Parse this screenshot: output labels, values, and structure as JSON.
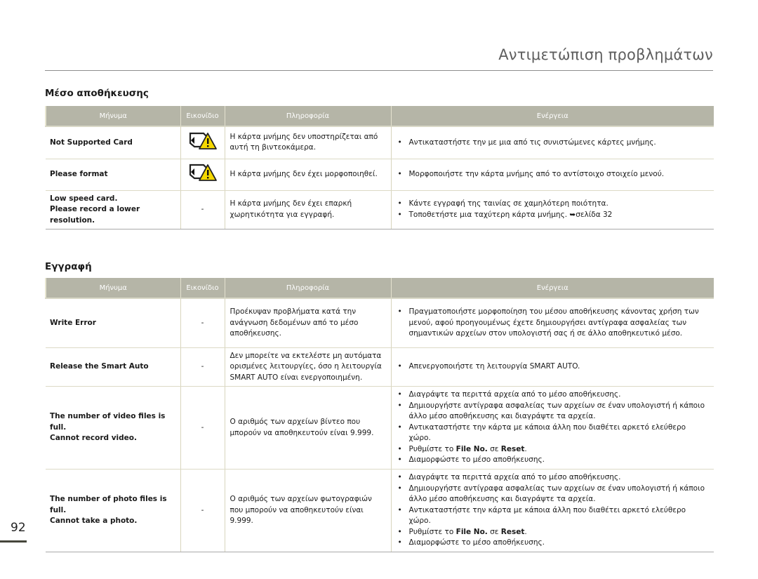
{
  "header": {
    "title": "Αντιμετώπιση προβλημάτων"
  },
  "columns": {
    "message": "Μήνυμα",
    "icon": "Εικονίδιο",
    "info": "Πληροφορία",
    "action": "Ενέργεια"
  },
  "sections": [
    {
      "title": "Μέσο αποθήκευσης",
      "rows": [
        {
          "message": "Not Supported Card",
          "icon": "card-warning-icon",
          "info": "Η κάρτα μνήμης δεν υποστηρίζεται από αυτή τη βιντεοκάμερα.",
          "actions": [
            "Αντικαταστήστε την με μια από τις συνιστώμενες κάρτες μνήμης."
          ]
        },
        {
          "message": "Please format",
          "icon": "card-warning-icon",
          "info": "Η κάρτα μνήμης δεν έχει μορφοποιηθεί.",
          "actions": [
            "Μορφοποιήστε την κάρτα μνήμης από το αντίστοιχο στοιχείο μενού."
          ]
        },
        {
          "message_lines": [
            "Low speed card.",
            "Please record a lower",
            "resolution."
          ],
          "icon": "-",
          "info": "Η κάρτα μνήμης δεν έχει επαρκή χωρητικότητα για εγγραφή.",
          "actions": [
            "Κάντε εγγραφή της ταινίας σε χαμηλότερη ποιότητα.",
            "Τοποθετήστε μια ταχύτερη κάρτα μνήμης. ➥σελίδα 32"
          ]
        }
      ]
    },
    {
      "title": "Εγγραφή",
      "rows": [
        {
          "message": "Write Error",
          "icon": "-",
          "info": "Προέκυψαν προβλήματα κατά την ανάγνωση δεδομένων από το μέσο αποθήκευσης.",
          "actions": [
            "Πραγματοποιήστε μορφοποίηση του μέσου αποθήκευσης κάνοντας χρήση των μενού, αφού προηγουμένως έχετε δημιουργήσει αντίγραφα ασφαλείας των σημαντικών αρχείων στον υπολογιστή σας ή σε άλλο αποθηκευτικό μέσο."
          ]
        },
        {
          "message": "Release the Smart Auto",
          "icon": "-",
          "info": "Δεν μπορείτε να εκτελέστε μη αυτόματα ορισμένες λειτουργίες, όσο η λειτουργία SMART AUTO είναι ενεργοποιημένη.",
          "actions": [
            "Απενεργοποιήστε τη λειτουργία SMART AUTO."
          ]
        },
        {
          "message_lines": [
            "The number of video files is",
            "full.",
            "Cannot record video."
          ],
          "icon": "-",
          "info": "Ο αριθμός των αρχείων βίντεο που μπορούν να αποθηκευτούν είναι 9.999.",
          "actions": [
            "Διαγράψτε τα περιττά αρχεία από το μέσο αποθήκευσης.",
            "Δημιουργήστε αντίγραφα ασφαλείας των αρχείων σε έναν υπολογιστή ή κάποιο άλλο μέσο αποθήκευσης και διαγράψτε τα αρχεία.",
            "Αντικαταστήστε την κάρτα με κάποια άλλη που διαθέτει αρκετό ελεύθερο χώρο."
          ],
          "reset_action": {
            "prefix": "Ρυθμίστε το ",
            "item": "File No.",
            "mid": " σε ",
            "value": "Reset",
            "suffix": "."
          },
          "final_action": "Διαμορφώστε το μέσο αποθήκευσης."
        },
        {
          "message_lines": [
            "The number of photo files is",
            "full.",
            "Cannot take a photo."
          ],
          "icon": "-",
          "info": "Ο αριθμός των αρχείων φωτογραφιών που μπορούν να αποθηκευτούν είναι 9.999.",
          "actions": [
            "Διαγράψτε τα περιττά αρχεία από το μέσο αποθήκευσης.",
            "Δημιουργήστε αντίγραφα ασφαλείας των αρχείων σε έναν υπολογιστή ή κάποιο άλλο μέσο αποθήκευσης και διαγράψτε τα αρχεία.",
            "Αντικαταστήστε την κάρτα με κάποια άλλη που διαθέτει αρκετό ελεύθερο χώρο."
          ],
          "reset_action": {
            "prefix": "Ρυθμίστε το ",
            "item": "File No.",
            "mid": " σε ",
            "value": "Reset",
            "suffix": "."
          },
          "final_action": "Διαμορφώστε το μέσο αποθήκευσης."
        }
      ]
    }
  ],
  "footer": {
    "page_number": "92"
  },
  "colors": {
    "header_bg": "#b5b5a7",
    "warning_yellow": "#f5d800"
  }
}
